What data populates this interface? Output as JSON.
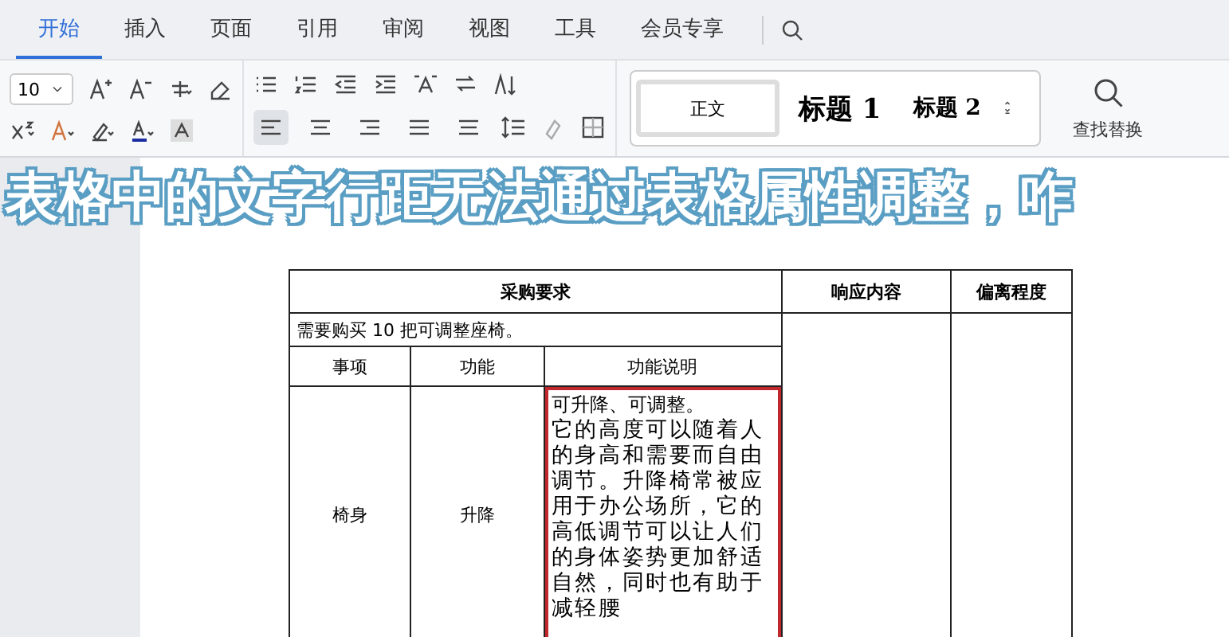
{
  "tabs": [
    {
      "label": "开始",
      "selected": true
    },
    {
      "label": "插入",
      "selected": false
    },
    {
      "label": "页面",
      "selected": false
    },
    {
      "label": "引用",
      "selected": false
    },
    {
      "label": "审阅",
      "selected": false
    },
    {
      "label": "视图",
      "selected": false
    },
    {
      "label": "工具",
      "selected": false
    },
    {
      "label": "会员专享",
      "selected": false
    }
  ],
  "font_size": "10",
  "alignment": [
    {
      "kind": "left",
      "selected": true
    },
    {
      "kind": "center",
      "selected": false
    },
    {
      "kind": "right",
      "selected": false
    },
    {
      "kind": "justify",
      "selected": false
    },
    {
      "kind": "distributed",
      "selected": false
    }
  ],
  "styles": [
    {
      "label": "正文",
      "kind": "body",
      "selected": true
    },
    {
      "label": "标题 1",
      "kind": "h1",
      "selected": false
    },
    {
      "label": "标题 2",
      "kind": "h2",
      "selected": false
    }
  ],
  "find_replace": "查找替换",
  "banner": "表格中的文字行距无法通过表格属性调整，咋",
  "table": {
    "headers": [
      "采购要求",
      "响应内容",
      "偏离程度"
    ],
    "requirement": "需要购买 10 把可调整座椅。",
    "sub_headers": [
      "事项",
      "功能",
      "功能说明"
    ],
    "rows": [
      {
        "item": "椅身",
        "function": "升降",
        "description": [
          "可升降、可调整。",
          "它的高度可以随着人的身高和需要而自由调节。升降椅常被应用于办公场所，它的高低调节可以让人们的身体姿势更加舒适自然，同时也有助于减轻腰"
        ],
        "highlighted": true
      }
    ]
  }
}
